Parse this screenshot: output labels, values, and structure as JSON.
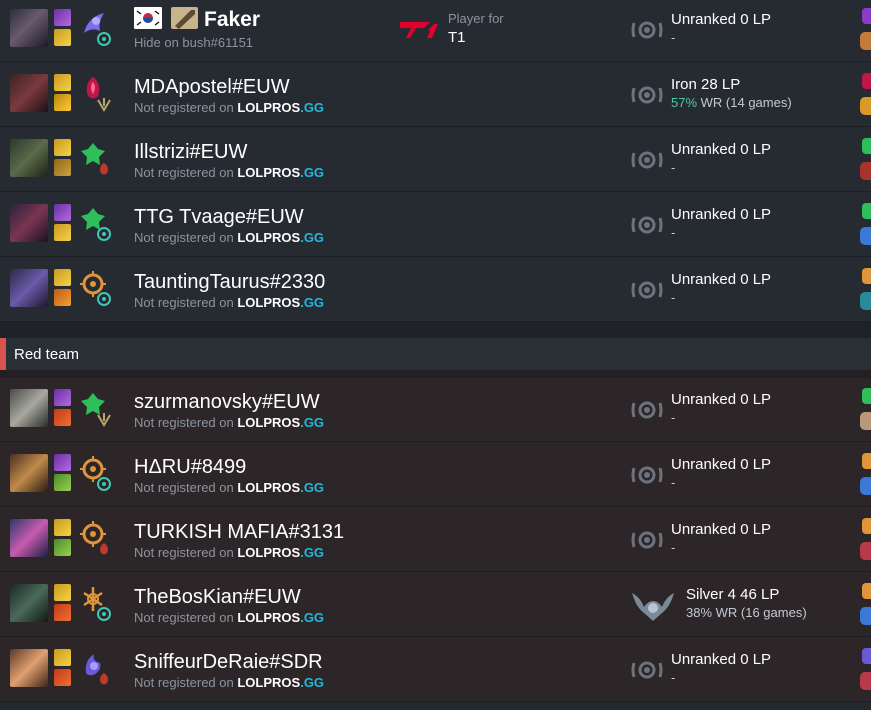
{
  "faker": {
    "name": "Faker",
    "tag": "Hide on bush#61151",
    "player_for_label": "Player for",
    "team": "T1",
    "rank": "Unranked 0 LP",
    "rank_sub": "-"
  },
  "common": {
    "not_registered": "Not registered on",
    "lolpros_a": "LOLPROS",
    "lolpros_b": ".GG"
  },
  "blue_rows": [
    {
      "name": "MDApostel#EUW",
      "rank": "Iron 28 LP",
      "wr_pct": "57%",
      "wr_rest": " WR (14 games)"
    },
    {
      "name": "Illstrizi#EUW",
      "rank": "Unranked 0 LP",
      "rank_sub": "-"
    },
    {
      "name": "TTG Tvaage#EUW",
      "rank": "Unranked 0 LP",
      "rank_sub": "-"
    },
    {
      "name": "TauntingTaurus#2330",
      "rank": "Unranked 0 LP",
      "rank_sub": "-"
    }
  ],
  "red_team": {
    "label": "Red team",
    "accent": "#d9534f"
  },
  "red_rows": [
    {
      "name": "szurmanovsky#EUW",
      "rank": "Unranked 0 LP",
      "rank_sub": "-"
    },
    {
      "name": "HΔRU#8499",
      "rank": "Unranked 0 LP",
      "rank_sub": "-"
    },
    {
      "name": "TURKISH MAFIA#3131",
      "rank": "Unranked 0 LP",
      "rank_sub": "-"
    },
    {
      "name": "TheBosKian#EUW",
      "rank": "Silver 4 46 LP",
      "rank_sub": "38% WR (16 games)"
    },
    {
      "name": "SniffeurDeRaie#SDR",
      "rank": "Unranked 0 LP",
      "rank_sub": "-"
    }
  ],
  "colors": {
    "accent_link": "#22b8dc",
    "winrate_good": "#4ec9a3"
  }
}
